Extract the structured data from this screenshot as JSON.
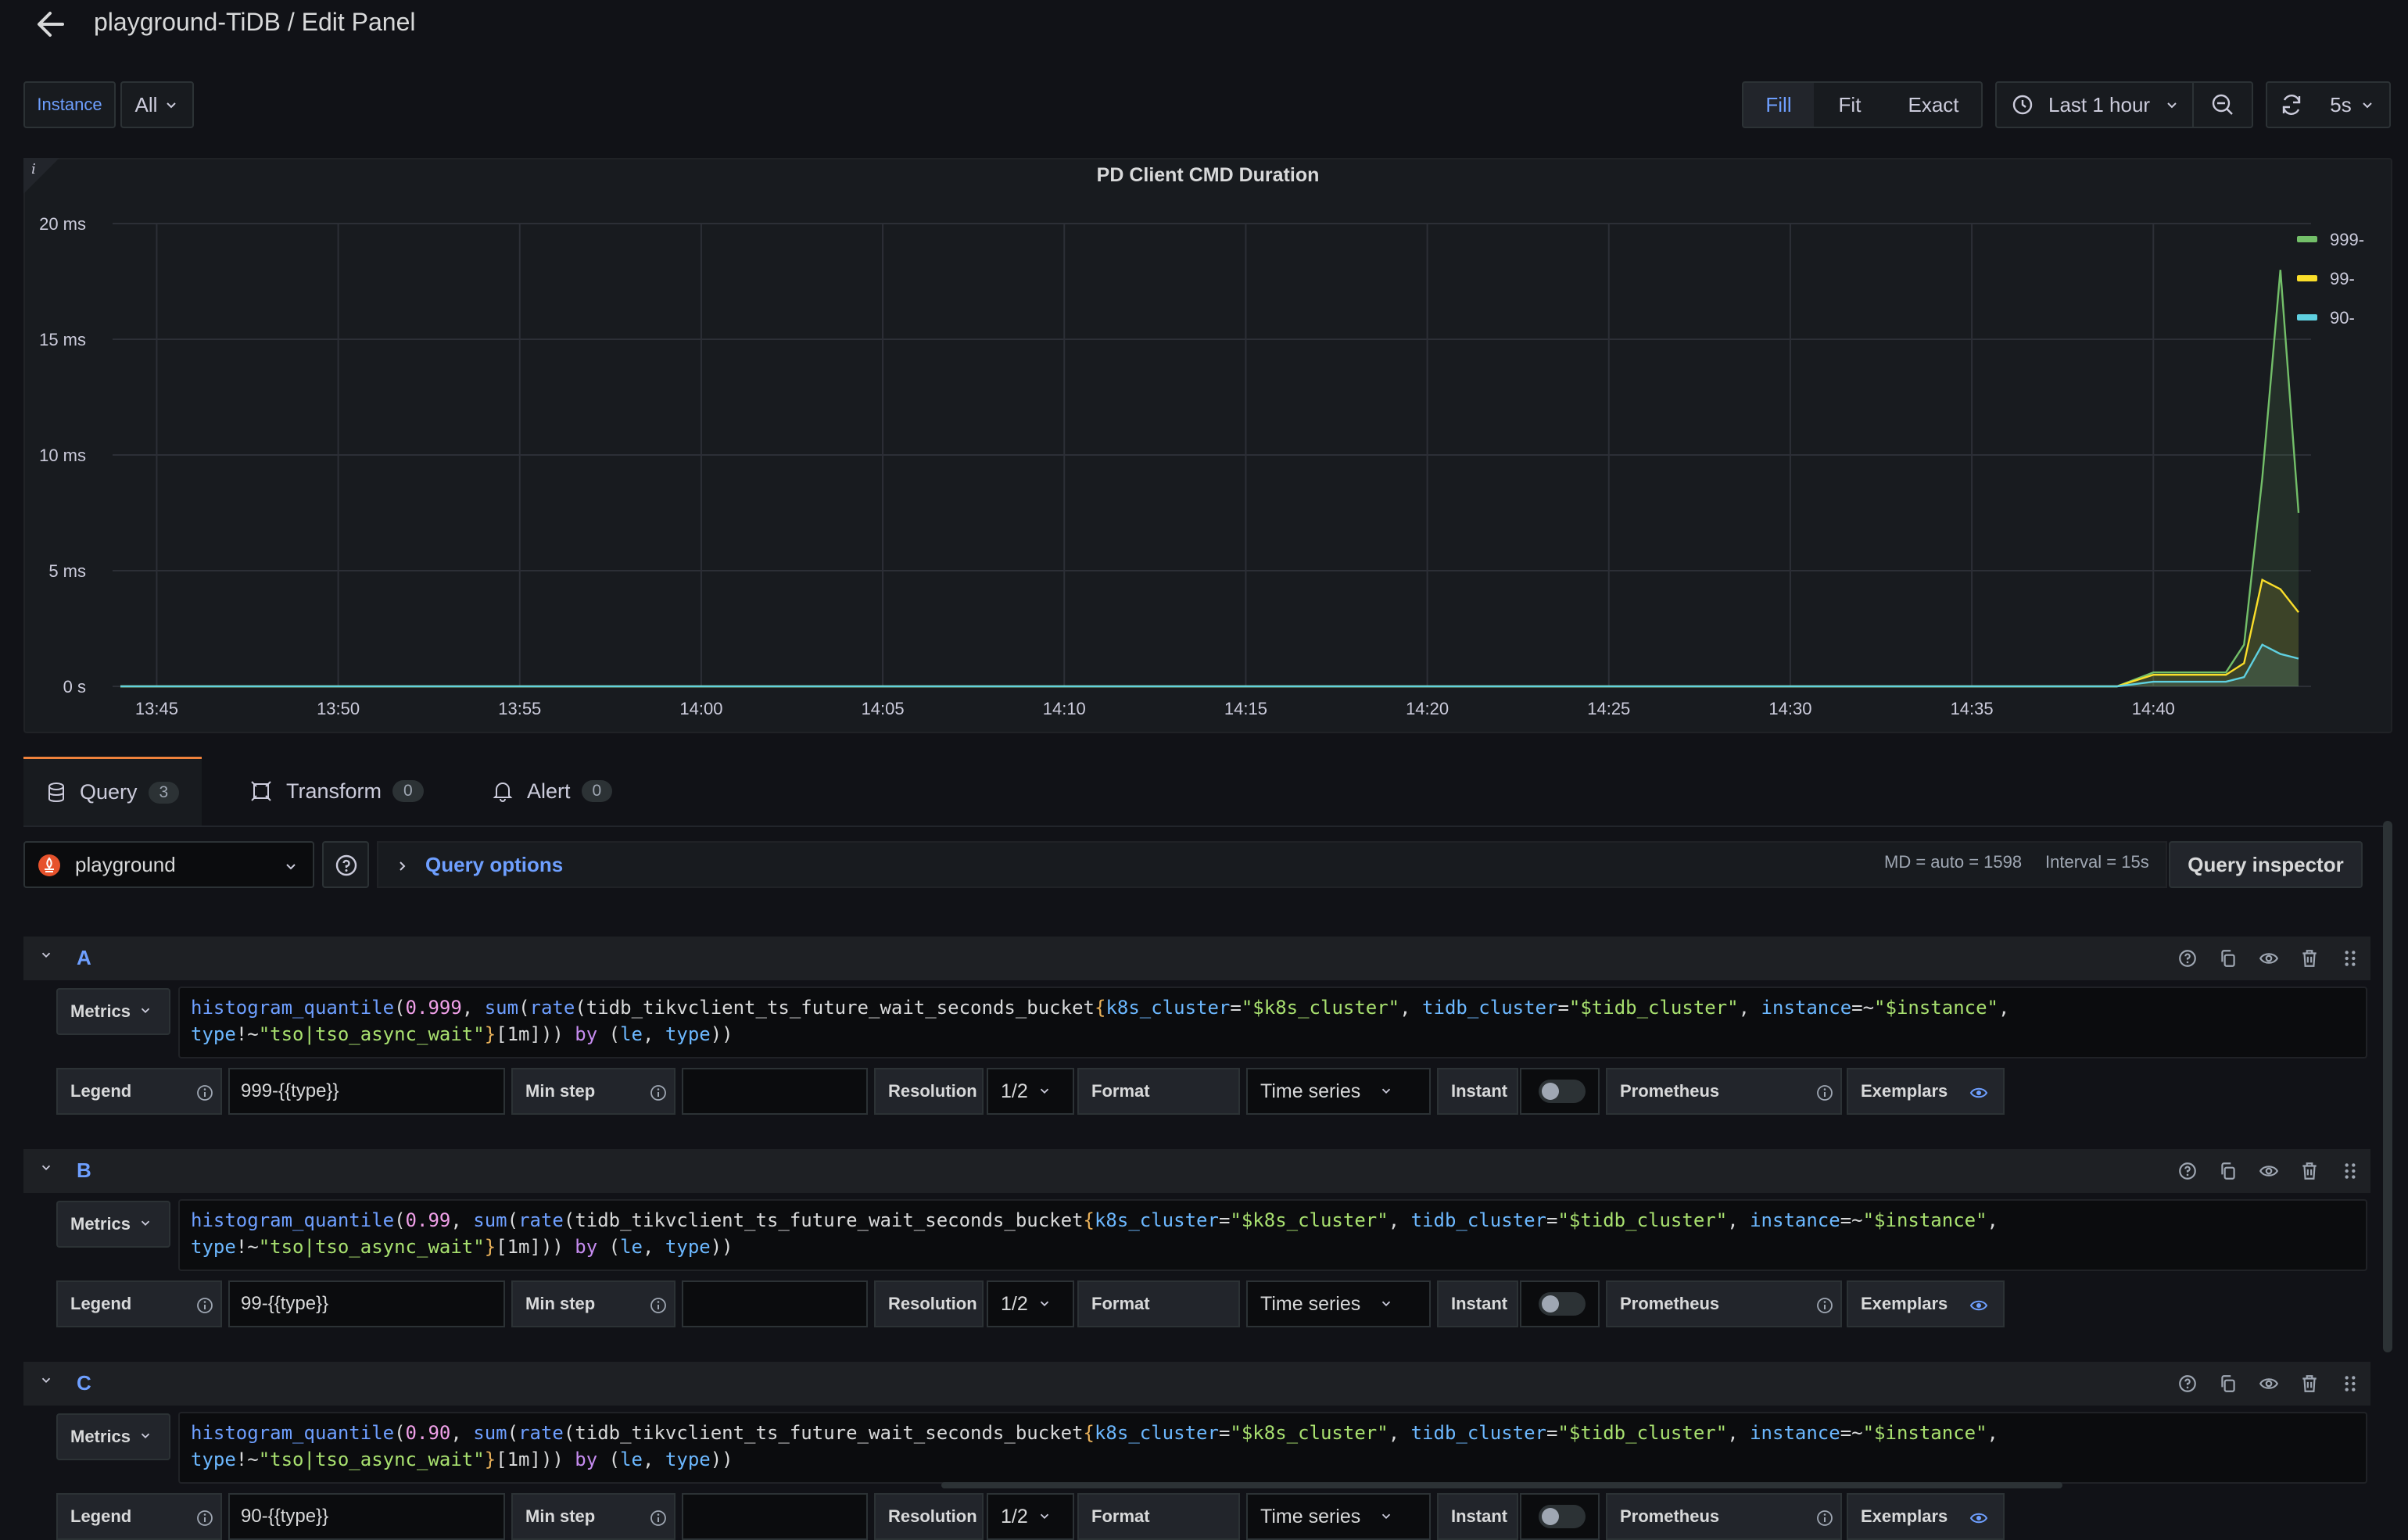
{
  "header": {
    "title": "playground-TiDB / Edit Panel"
  },
  "variables": {
    "label": "Instance",
    "value": "All"
  },
  "toolbar": {
    "fill": "Fill",
    "fit": "Fit",
    "exact": "Exact",
    "time_range": "Last 1 hour",
    "refresh_interval": "5s"
  },
  "panel": {
    "title": "PD Client CMD Duration",
    "info": "i"
  },
  "chart_data": {
    "type": "line",
    "title": "PD Client CMD Duration",
    "ylabel": "",
    "y_unit": "ms",
    "ylim": [
      0,
      20
    ],
    "y_ticks": [
      "20 ms",
      "15 ms",
      "10 ms",
      "5 ms",
      "0 s"
    ],
    "y_tick_values": [
      20,
      15,
      10,
      5,
      0
    ],
    "x_ticks": [
      "13:45",
      "13:50",
      "13:55",
      "14:00",
      "14:05",
      "14:10",
      "14:15",
      "14:20",
      "14:25",
      "14:30",
      "14:35",
      "14:40"
    ],
    "x_range_minutes": [
      "13:44",
      "14:44"
    ],
    "grid": true,
    "legend_position": "right",
    "x": [
      "13:44",
      "14:39",
      "14:40",
      "14:41",
      "14:42",
      "14:42:30",
      "14:43",
      "14:43:30",
      "14:44"
    ],
    "series": [
      {
        "name": "999-",
        "color": "#73bf69",
        "values": [
          0,
          0,
          0.6,
          0.6,
          0.6,
          1.8,
          9,
          18,
          7.5
        ]
      },
      {
        "name": "99-",
        "color": "#fade2a",
        "values": [
          0,
          0,
          0.5,
          0.5,
          0.5,
          1.0,
          4.6,
          4.2,
          3.2
        ]
      },
      {
        "name": "90-",
        "color": "#5fd0e0",
        "values": [
          0,
          0,
          0.2,
          0.2,
          0.2,
          0.4,
          1.8,
          1.4,
          1.2
        ]
      }
    ]
  },
  "tabs": [
    {
      "label": "Query",
      "count": "3"
    },
    {
      "label": "Transform",
      "count": "0"
    },
    {
      "label": "Alert",
      "count": "0"
    }
  ],
  "datasource": {
    "name": "playground"
  },
  "query_options": {
    "label": "Query options",
    "md": "MD = auto = 1598",
    "interval": "Interval = 15s",
    "inspector": "Query inspector"
  },
  "queries": [
    {
      "letter": "A",
      "quantile": "0.999",
      "legend": "999-{{type}}"
    },
    {
      "letter": "B",
      "quantile": "0.99",
      "legend": "99-{{type}}"
    },
    {
      "letter": "C",
      "quantile": "0.90",
      "legend": "90-{{type}}"
    }
  ],
  "query_ui": {
    "metrics": "Metrics",
    "legend": "Legend",
    "min_step": "Min step",
    "resolution": "Resolution",
    "resolution_value": "1/2",
    "format": "Format",
    "format_value": "Time series",
    "instant": "Instant",
    "prometheus": "Prometheus",
    "exemplars": "Exemplars"
  },
  "expr": {
    "fn1": "histogram_quantile",
    "fn2": "sum",
    "fn3": "rate",
    "metric": "tidb_tikvclient_ts_future_wait_seconds_bucket",
    "l1": "k8s_cluster",
    "v1": "\"$k8s_cluster\"",
    "l2": "tidb_cluster",
    "v2": "\"$tidb_cluster\"",
    "l3": "instance",
    "v3": "\"$instance\"",
    "l4": "type",
    "v4": "\"tso|tso_async_wait\"",
    "range": "[1m]",
    "by": "by",
    "g1": "le",
    "g2": "type"
  }
}
